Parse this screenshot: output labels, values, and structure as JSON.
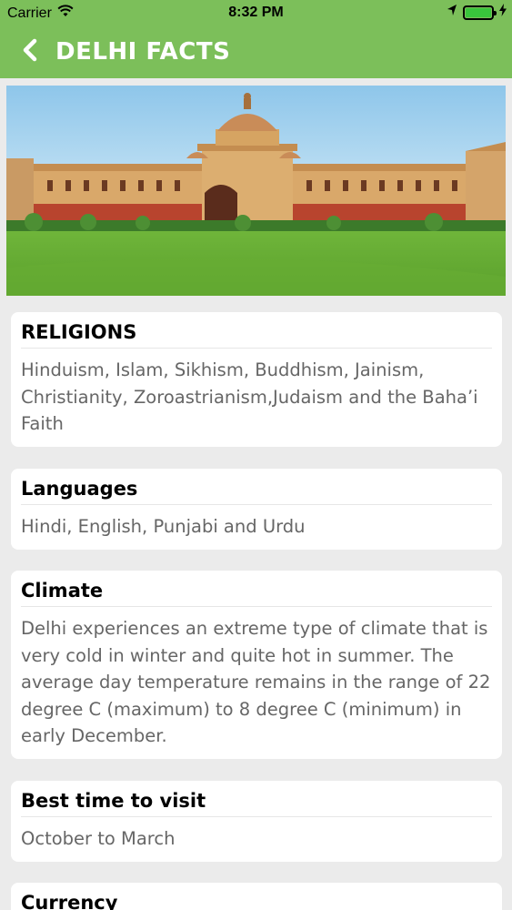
{
  "status_bar": {
    "carrier": "Carrier",
    "time": "8:32 PM"
  },
  "navbar": {
    "title": "DELHI FACTS",
    "back_icon": "chevron-left-icon",
    "background": "#7cbf5a"
  },
  "hero": {
    "image": "Government building with dome and green lawn"
  },
  "facts": [
    {
      "heading": "RELIGIONS",
      "text": "Hinduism, Islam, Sikhism, Buddhism, Jainism, Christianity, Zoroastrianism,Judaism and the Baha’i Faith"
    },
    {
      "heading": "Languages",
      "text": "Hindi, English, Punjabi and Urdu"
    },
    {
      "heading": "Climate",
      "text": "Delhi experiences an extreme type of climate that is very cold in winter and quite hot in summer. The average day temperature remains in the range of 22 degree C (maximum) to 8 degree C (minimum) in early December."
    },
    {
      "heading": "Best time to visit",
      "text": "October to March"
    },
    {
      "heading": "Currency",
      "text": ""
    }
  ]
}
